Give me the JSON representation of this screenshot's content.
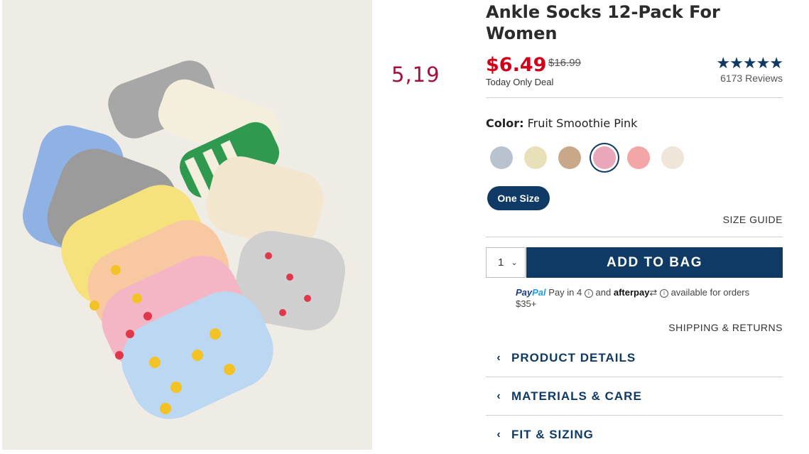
{
  "overlay": {
    "number": "5,19"
  },
  "product": {
    "title": "Ankle Socks 12-Pack For Women",
    "price": "$6.49",
    "old_price": "$16.99",
    "deal": "Today Only Deal",
    "stars": "★★★★★",
    "reviews": "6173 Reviews"
  },
  "color": {
    "label": "Color:",
    "value": "Fruit Smoothie Pink",
    "swatches": [
      {
        "name": "swatch-1",
        "color": "#b9c3cf"
      },
      {
        "name": "swatch-2",
        "color": "#e8e0b8"
      },
      {
        "name": "swatch-3",
        "color": "#c9a88a"
      },
      {
        "name": "swatch-4",
        "color": "#e9a7b9",
        "selected": true
      },
      {
        "name": "swatch-5",
        "color": "#f3a6a6"
      },
      {
        "name": "swatch-6",
        "color": "#efe5d8"
      }
    ]
  },
  "size": {
    "selected": "One Size",
    "guide": "SIZE GUIDE"
  },
  "bag": {
    "qty": "1",
    "add_label": "ADD TO BAG"
  },
  "payment": {
    "paypal_a": "Pay",
    "paypal_b": "Pal",
    "paypal_text": "Pay in 4",
    "and": "and",
    "afterpay": "afterpay",
    "available": "available for orders $35+"
  },
  "shipping": "SHIPPING & RETURNS",
  "accordion": [
    "PRODUCT DETAILS",
    "MATERIALS & CARE",
    "FIT & SIZING"
  ],
  "colors": {
    "navy": "#0f3a66",
    "sale_red": "#d0021b",
    "overlay_red": "#a3123a"
  }
}
